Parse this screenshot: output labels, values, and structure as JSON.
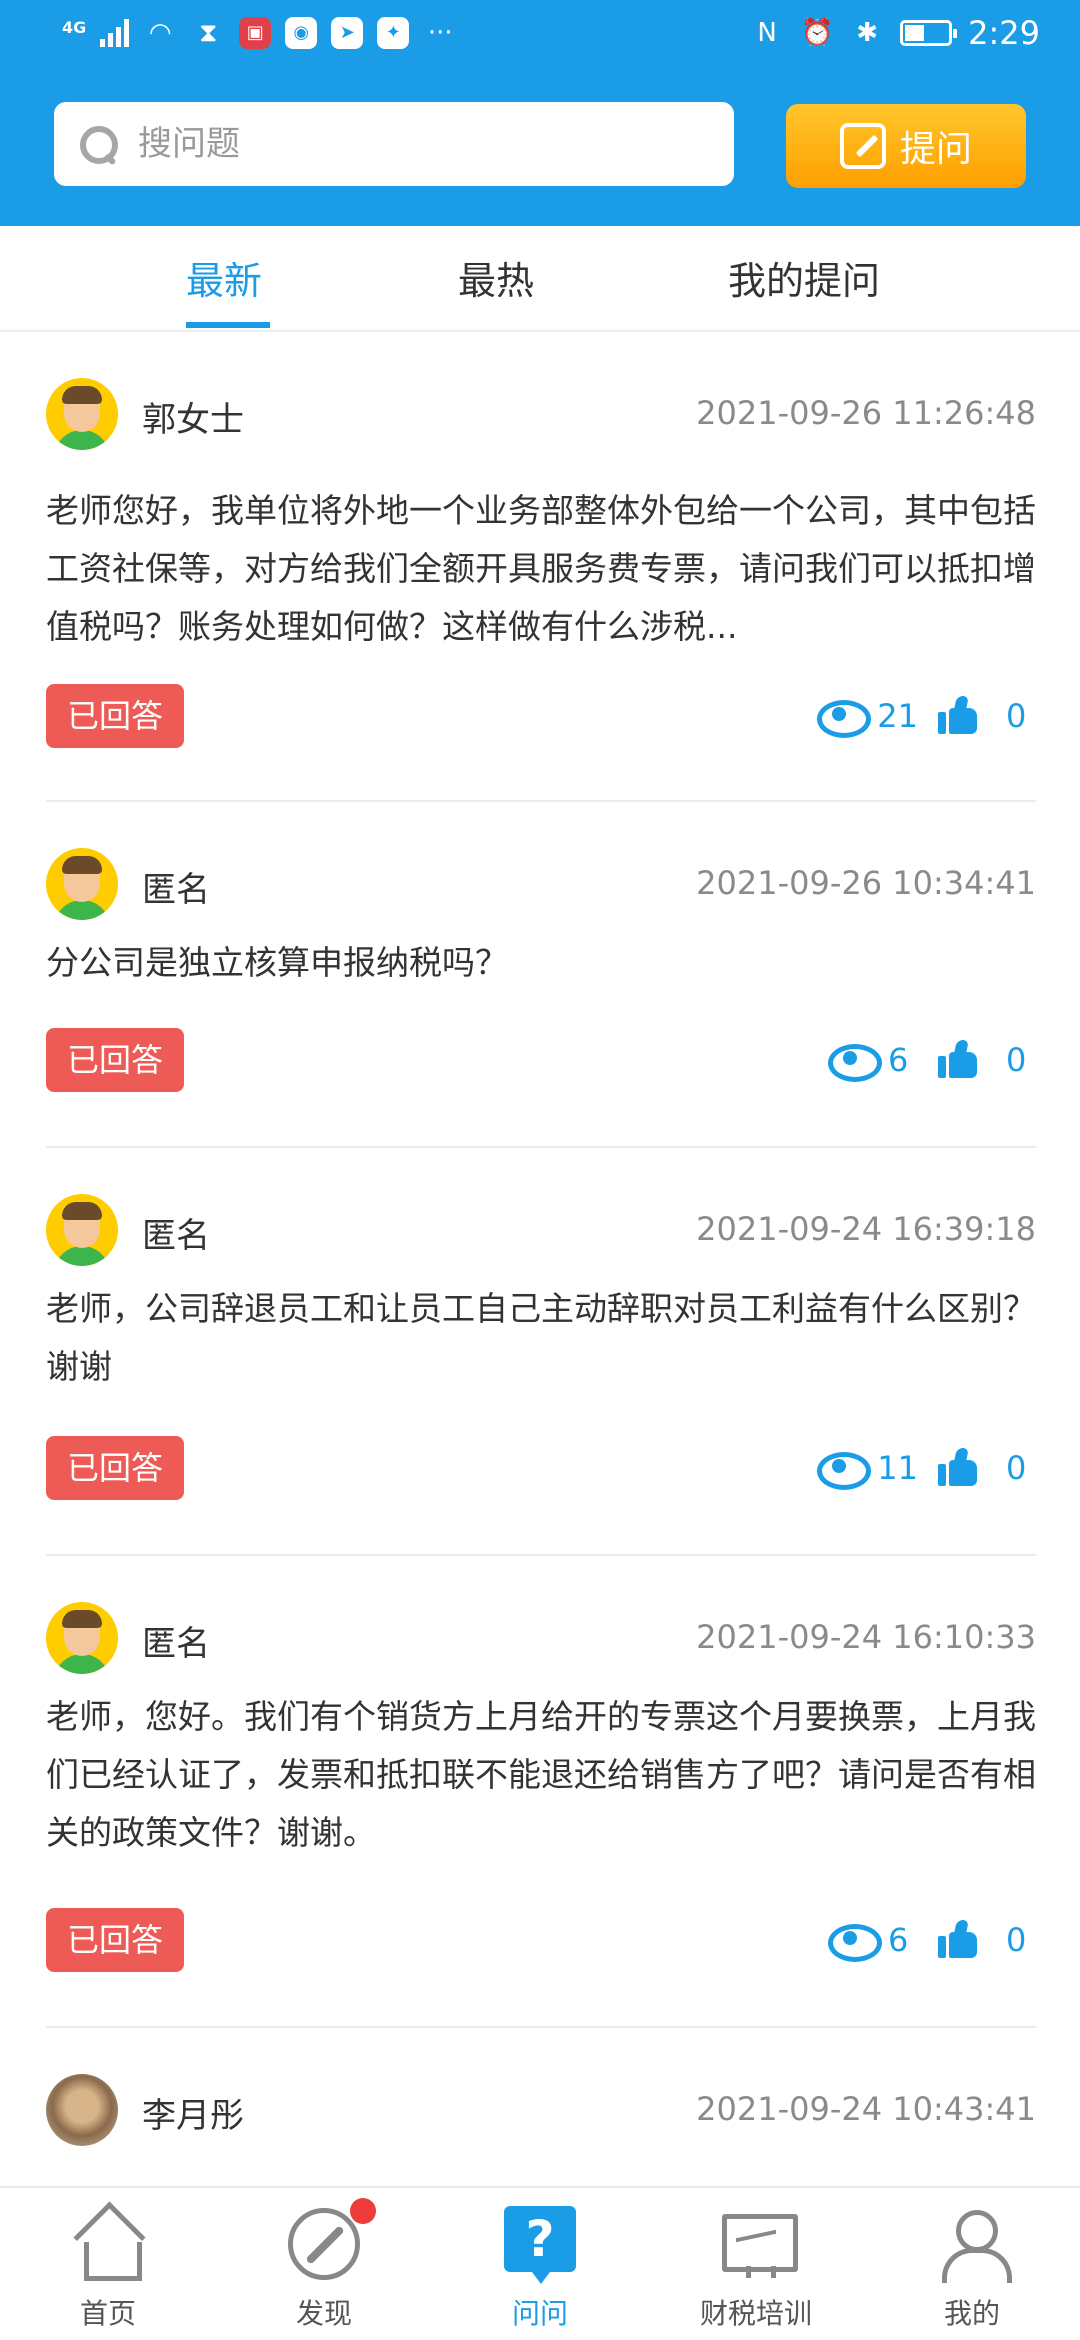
{
  "status_bar": {
    "network": "4G",
    "time": "2:29"
  },
  "search": {
    "placeholder": "搜问题"
  },
  "ask_button": {
    "label": "提问"
  },
  "tabs": [
    {
      "label": "最新",
      "active": true
    },
    {
      "label": "最热",
      "active": false
    },
    {
      "label": "我的提问",
      "active": false
    }
  ],
  "questions": [
    {
      "author": "郭女士",
      "time": "2021-09-26 11:26:48",
      "content": "老师您好，我单位将外地一个业务部整体外包给一个公司，其中包括工资社保等，对方给我们全额开具服务费专票，请问我们可以抵扣增值税吗？账务处理如何做？这样做有什么涉税...",
      "status": "已回答",
      "views": "21",
      "likes": "0"
    },
    {
      "author": "匿名",
      "time": "2021-09-26 10:34:41",
      "content": "分公司是独立核算申报纳税吗？",
      "status": "已回答",
      "views": "6",
      "likes": "0"
    },
    {
      "author": "匿名",
      "time": "2021-09-24 16:39:18",
      "content": "老师，公司辞退员工和让员工自己主动辞职对员工利益有什么区别？谢谢",
      "status": "已回答",
      "views": "11",
      "likes": "0"
    },
    {
      "author": "匿名",
      "time": "2021-09-24 16:10:33",
      "content": "老师，您好。我们有个销货方上月给开的专票这个月要换票，上月我们已经认证了，发票和抵扣联不能退还给销售方了吧？请问是否有相关的政策文件？谢谢。",
      "status": "已回答",
      "views": "6",
      "likes": "0"
    },
    {
      "author": "李月彤",
      "time": "2021-09-24 10:43:41"
    }
  ],
  "bottom_nav": [
    {
      "label": "首页",
      "icon": "home-icon"
    },
    {
      "label": "发现",
      "icon": "compass-icon",
      "badge_dot": true
    },
    {
      "label": "问问",
      "icon": "question-icon",
      "active": true
    },
    {
      "label": "财税培训",
      "icon": "monitor-icon"
    },
    {
      "label": "我的",
      "icon": "user-icon"
    }
  ],
  "colors": {
    "primary": "#1a9de6",
    "accent": "#ff9f00",
    "answered_badge": "#ee5a55"
  }
}
